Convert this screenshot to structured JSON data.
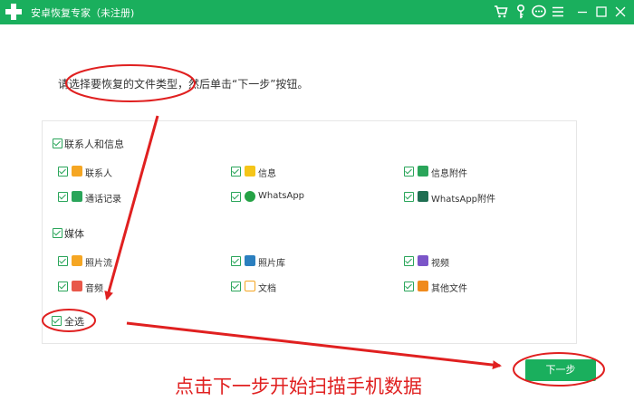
{
  "app": {
    "title": "安卓恢复专家（未注册)"
  },
  "titlebar_icons": [
    "cart-icon",
    "key-icon",
    "chat-icon",
    "menu-icon",
    "minimize-icon",
    "maximize-icon",
    "close-icon"
  ],
  "instruction": "请选择要恢复的文件类型，然后单击“下一步”按钮。",
  "groups": {
    "contacts": {
      "label": "联系人和信息",
      "items": [
        {
          "label": "联系人",
          "icon": "contacts-icon",
          "color": "#f5a623"
        },
        {
          "label": "信息",
          "icon": "message-icon",
          "color": "#f5c518"
        },
        {
          "label": "信息附件",
          "icon": "attachment-icon",
          "color": "#2aa55a"
        },
        {
          "label": "通话记录",
          "icon": "phone-icon",
          "color": "#2aa55a"
        },
        {
          "label": "WhatsApp",
          "icon": "whatsapp-icon",
          "color": "#25a245"
        },
        {
          "label": "WhatsApp附件",
          "icon": "whatsapp-attachment-icon",
          "color": "#1f6f52"
        }
      ]
    },
    "media": {
      "label": "媒体",
      "items": [
        {
          "label": "照片流",
          "icon": "photo-stream-icon",
          "color": "#f5a623"
        },
        {
          "label": "照片库",
          "icon": "photo-library-icon",
          "color": "#2b7fbf"
        },
        {
          "label": "视频",
          "icon": "video-icon",
          "color": "#7b55c8"
        },
        {
          "label": "音频",
          "icon": "audio-icon",
          "color": "#e8584a"
        },
        {
          "label": "文档",
          "icon": "document-icon",
          "color": "#f5a623"
        },
        {
          "label": "其他文件",
          "icon": "other-files-icon",
          "color": "#f08a1c"
        }
      ]
    }
  },
  "select_all": "全选",
  "next_button": "下一步",
  "annotation": "点击下一步开始扫描手机数据",
  "colors": {
    "brand": "#1aaf5d",
    "annotation_red": "#e02020"
  }
}
